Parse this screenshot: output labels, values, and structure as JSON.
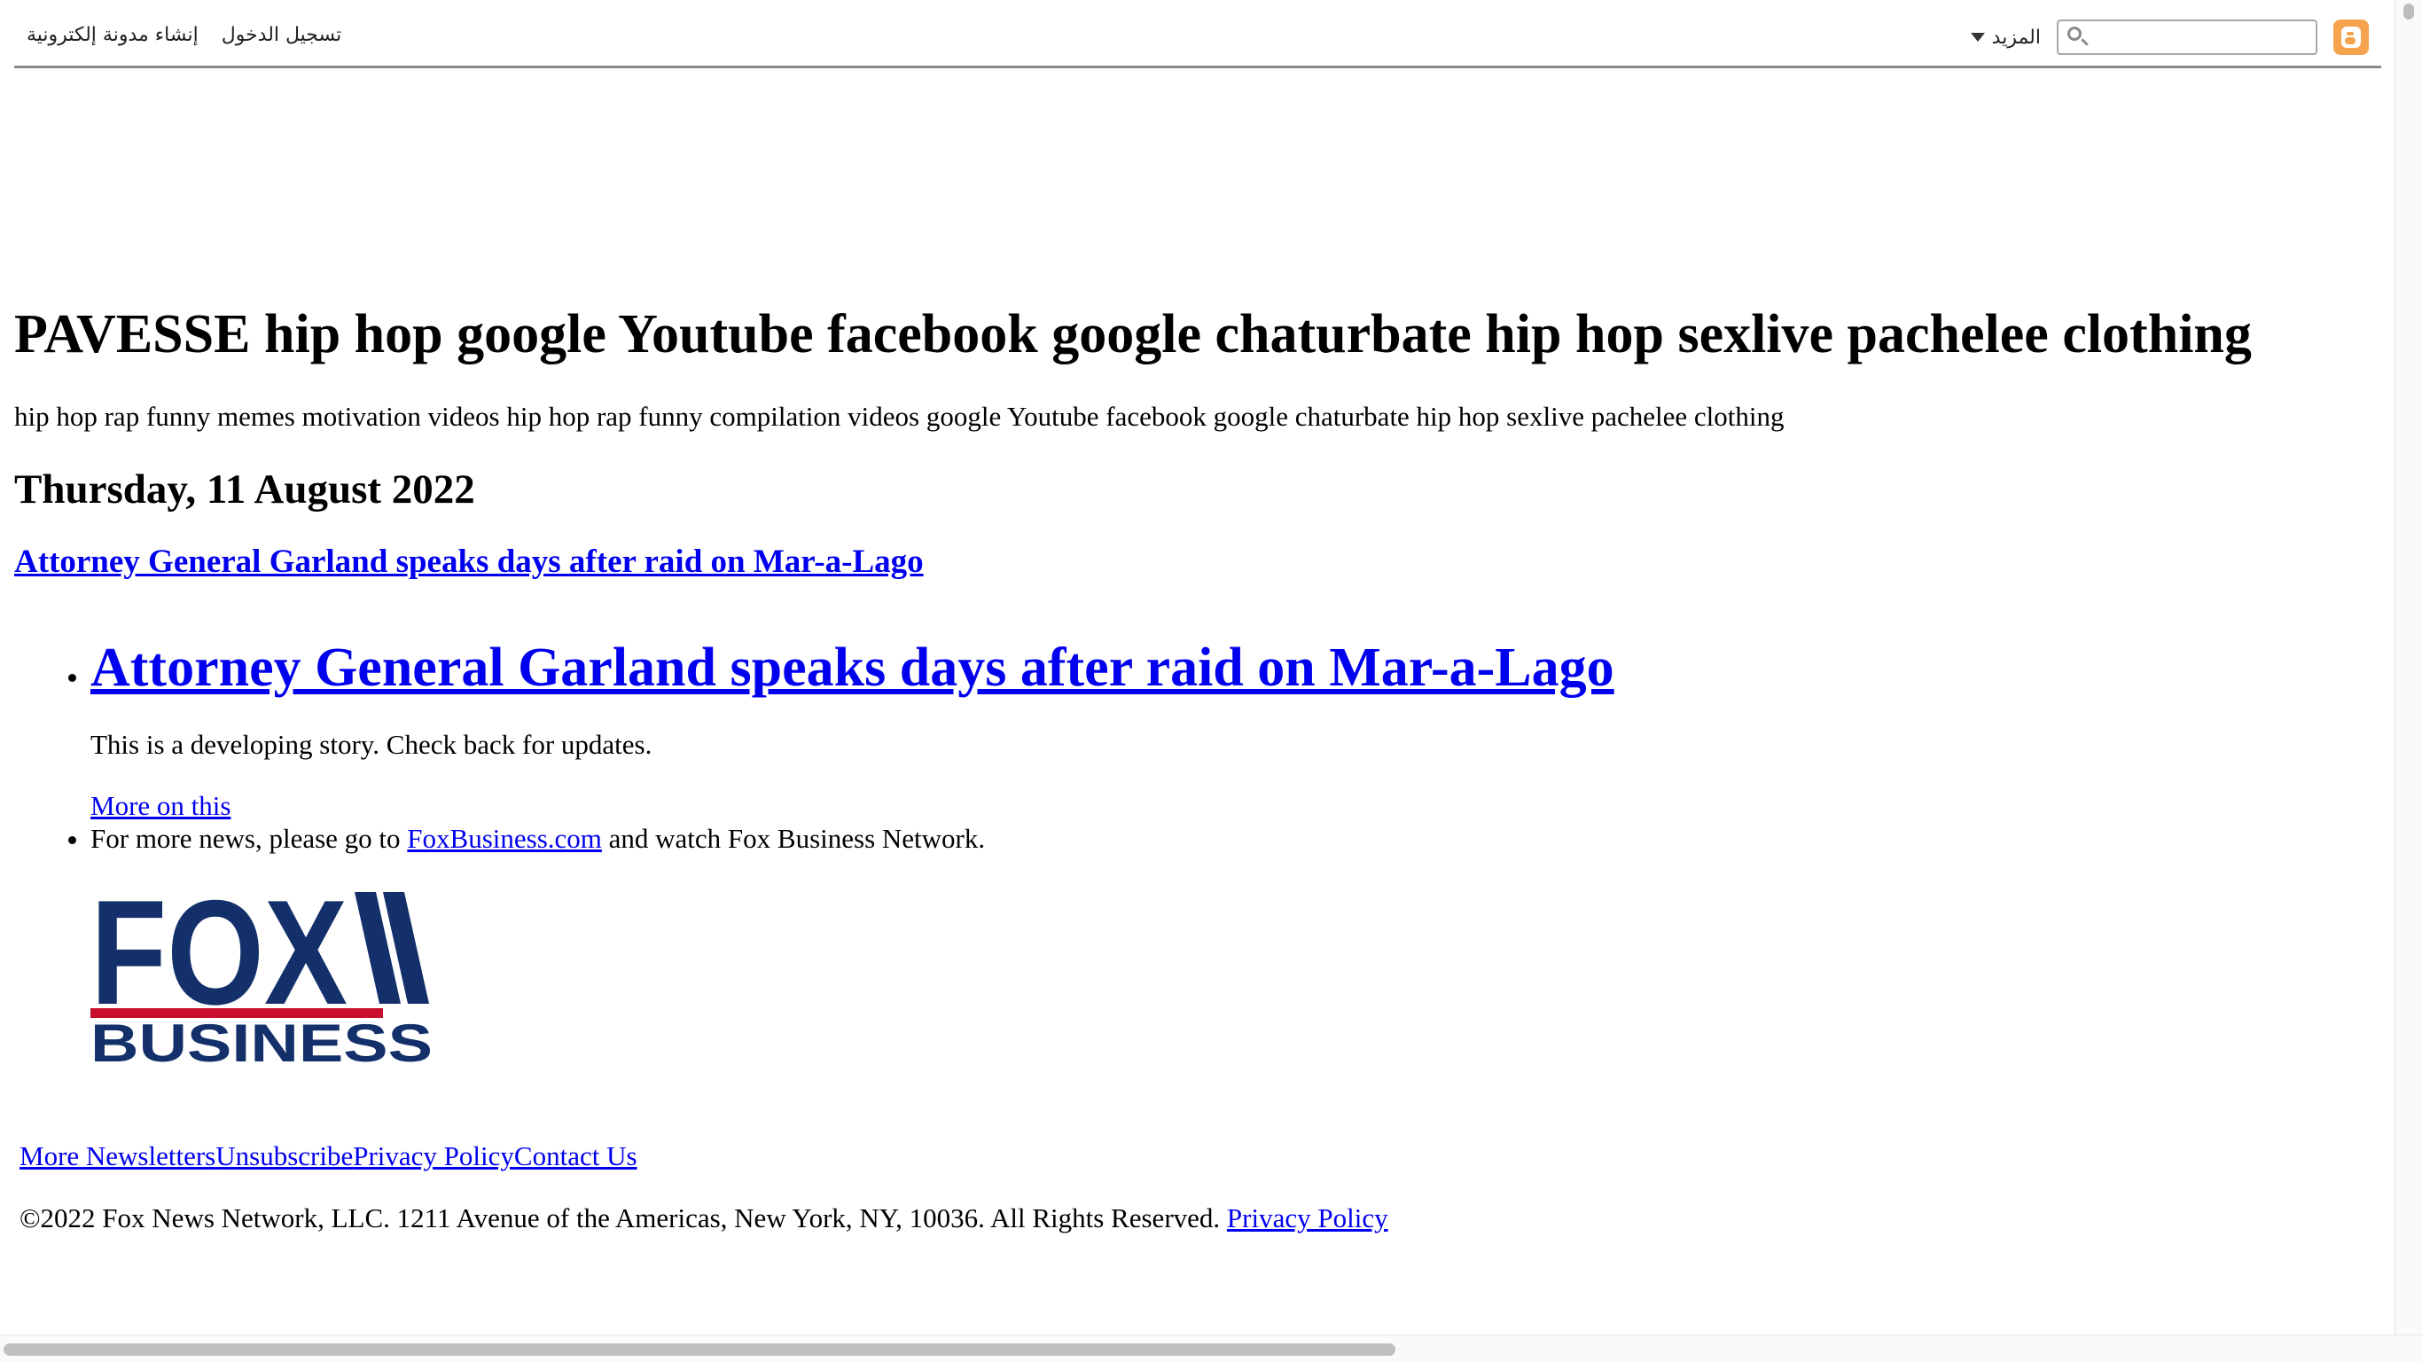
{
  "navbar": {
    "sign_in": "تسجيل الدخول",
    "create_blog": "إنشاء مدونة إلكترونية",
    "more": "المزيد",
    "search_placeholder": "",
    "brand_color": "#f6a34e"
  },
  "blog": {
    "title": "PAVESSE hip hop google Youtube facebook google chaturbate hip hop sexlive pachelee clothing",
    "description": "hip hop rap funny memes motivation videos hip hop rap funny compilation videos google Youtube facebook google chaturbate hip hop sexlive pachelee clothing"
  },
  "post": {
    "date": "Thursday, 11 August 2022",
    "title": "Attorney General Garland speaks days after raid on Mar-a-Lago",
    "headline": "Attorney General Garland speaks days after raid on Mar-a-Lago",
    "body": "This is a developing story. Check back for updates.",
    "more_link": "More on this",
    "more_news_prefix": "For more news, please go to ",
    "more_news_link": "FoxBusiness.com",
    "more_news_suffix": " and watch Fox Business Network.",
    "logo": {
      "line1": "FOX",
      "line2": "BUSINESS",
      "navy": "#13306b",
      "red": "#c8102e"
    }
  },
  "footer": {
    "links": [
      "More Newsletters",
      "Unsubscribe",
      "Privacy Policy",
      "Contact Us"
    ],
    "copyright": "©2022 Fox News Network, LLC. 1211 Avenue of the Americas, New York, NY, 10036. All Rights Reserved. ",
    "privacy_link": "Privacy Policy"
  },
  "colors": {
    "link": "#0000ee",
    "text": "#000000"
  }
}
